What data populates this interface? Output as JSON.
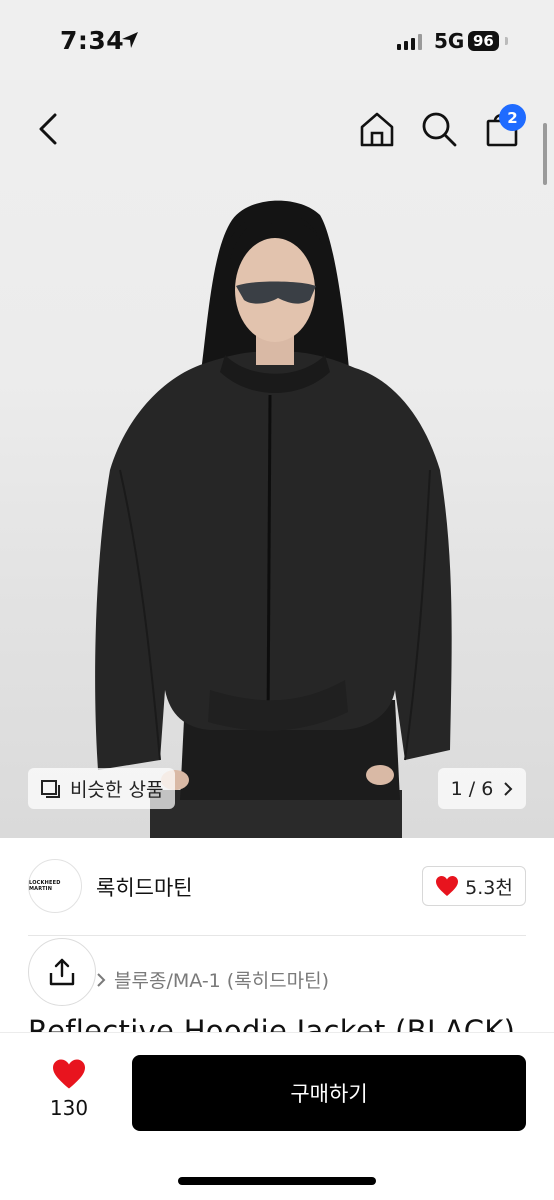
{
  "status_bar": {
    "time": "7:34",
    "network": "5G",
    "battery": "96"
  },
  "nav": {
    "back_icon": "chevron-left-icon",
    "home_icon": "home-icon",
    "search_icon": "search-icon",
    "cart_icon": "shopping-bag-icon",
    "cart_badge": "2"
  },
  "gallery": {
    "similar_label": "비슷한 상품",
    "page_counter": "1 / 6",
    "current_page": 1,
    "total_pages": 6
  },
  "store": {
    "logo_text": "LOCKHEED MARTIN",
    "name": "록히드마틴",
    "likes": "5.3천"
  },
  "product": {
    "breadcrumb": "블루종/MA-1 (록히드마틴)",
    "title": "Reflective Hoodie Jacket (BLACK)"
  },
  "bottom_bar": {
    "wish_count": "130",
    "buy_label": "구매하기"
  },
  "colors": {
    "accent": "#1f6bff",
    "heart": "#e8141e",
    "buy_button": "#000000"
  }
}
